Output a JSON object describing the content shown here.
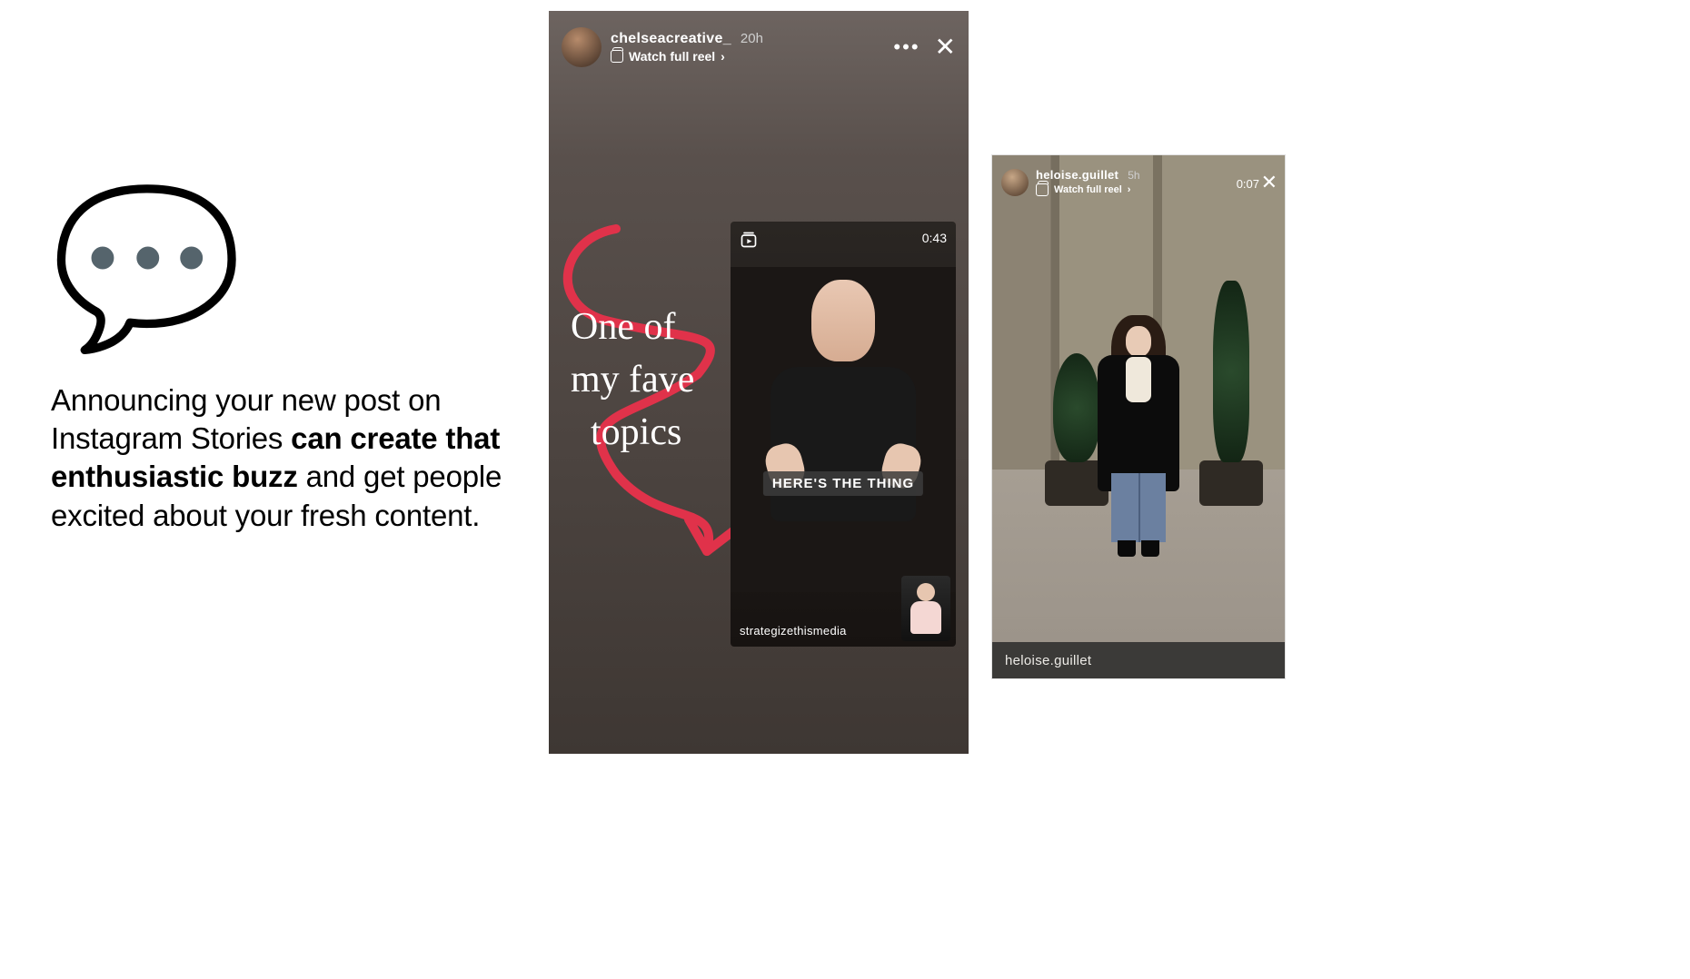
{
  "left": {
    "emoji": "💬",
    "text_pre": "Announcing your new post on Instagram Stories ",
    "text_bold": "can create that enthusiastic buzz",
    "text_post": " and get people excited about your fresh content."
  },
  "story1": {
    "username": "chelseacreative_",
    "age": "20h",
    "watch_label": "Watch full reel",
    "chevron": "›",
    "annotation_l1": "One of",
    "annotation_l2": "my fave",
    "annotation_l3": "topics",
    "reel": {
      "duration": "0:43",
      "caption": "HERE'S THE THING",
      "handle": "strategizethismedia"
    },
    "more": "•••",
    "close": "✕"
  },
  "story2": {
    "username": "heloise.guillet",
    "age": "5h",
    "watch_label": "Watch full reel",
    "chevron": "›",
    "time": "0:07",
    "close": "✕",
    "footer_handle": "heloise.guillet"
  }
}
